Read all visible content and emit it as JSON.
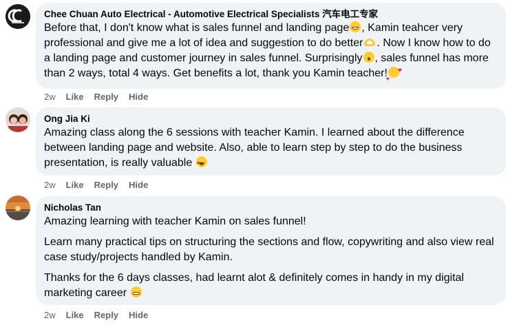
{
  "comments": [
    {
      "author": "Chee Chuan Auto Electrical - Automotive Electrical Specialists 汽车电工专家",
      "avatar": "cc-logo-avatar",
      "paragraphs": [
        [
          "Before that, I don't know what is sales funnel and landing page",
          "grinning-face-emoji",
          ", Kamin teahcer very professional and give me a lot of idea and suggestion to do better",
          "heart-hands-emoji",
          ". Now I know how to do a landing page and customer journey in sales funnel. Surprisingly",
          "surprised-face-emoji",
          ", sales funnel has more than 2 ways, total 4 ways. Get benefits a lot, thank you Kamin teacher!",
          "smiling-face-with-hearts-emoji"
        ]
      ],
      "time": "2w",
      "like": "Like",
      "reply": "Reply",
      "hide": "Hide"
    },
    {
      "author": "Ong Jia Ki",
      "avatar": "profile-photo-avatar",
      "paragraphs": [
        [
          "Amazing class along the 6 sessions with teacher Kamin. I learned about the difference between landing page and website. Also, able to learn step by step to do the business presentation, is really valuable ",
          "heart-eyes-emoji"
        ]
      ],
      "time": "2w",
      "like": "Like",
      "reply": "Reply",
      "hide": "Hide"
    },
    {
      "author": "Nicholas Tan",
      "avatar": "sunset-photo-avatar",
      "paragraphs": [
        [
          "Amazing learning with teacher Kamin on sales funnel!"
        ],
        [
          "Learn many practical tips on structuring the sections and flow, copywriting and also view real case study/projects handled by Kamin."
        ],
        [
          "Thanks for the 6 days classes, had learnt alot & definitely comes in handy in my digital marketing career ",
          "grimacing-face-emoji"
        ]
      ],
      "time": "2w",
      "like": "Like",
      "reply": "Reply",
      "hide": "Hide"
    }
  ],
  "colors": {
    "bubble": "#f0f2f5",
    "text": "#050505",
    "secondary": "#65676b"
  }
}
